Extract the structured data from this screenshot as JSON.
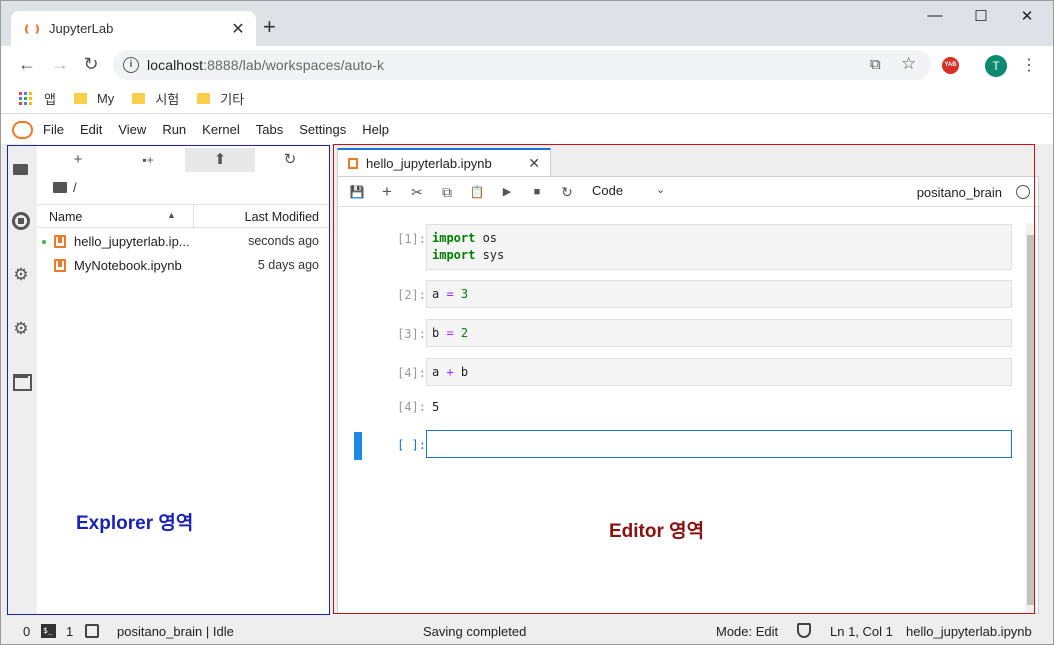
{
  "browser": {
    "tab_title": "JupyterLab",
    "tab_close": "✕",
    "new_tab": "+",
    "window_controls": {
      "minimize": "—",
      "maximize": "☐",
      "close": "✕"
    },
    "url_host": "localhost",
    "url_rest": ":8888/lab/workspaces/auto-k",
    "nav": {
      "back": "←",
      "forward": "→",
      "reload": "↻"
    },
    "info_glyph": "i",
    "translate_glyph": "⧉",
    "star_glyph": "☆",
    "yab_label": "YAB",
    "avatar_letter": "T",
    "menu_glyph": "⋮",
    "bookmarks": [
      "앱",
      "My",
      "시험",
      "기타"
    ]
  },
  "menubar": {
    "items": [
      "File",
      "Edit",
      "View",
      "Run",
      "Kernel",
      "Tabs",
      "Settings",
      "Help"
    ]
  },
  "sidebar": {
    "icons": [
      "folder-icon",
      "running-icon",
      "commands-icon",
      "settings-icon",
      "tabs-icon"
    ],
    "running_glyph": "",
    "commands_glyph": "⚙",
    "settings_glyph": "⚙"
  },
  "filebrowser": {
    "toolbar": {
      "new_launcher": "+",
      "new_folder": "▪+",
      "upload": "⬆",
      "refresh": "↻"
    },
    "breadcrumb": "/",
    "header": {
      "name": "Name",
      "modified": "Last Modified",
      "sort_glyph": "▲"
    },
    "files": [
      {
        "name": "hello_jupyterlab.ip...",
        "modified": "seconds ago",
        "running": true
      },
      {
        "name": "MyNotebook.ipynb",
        "modified": "5 days ago",
        "running": false
      }
    ]
  },
  "annotations": {
    "explorer": "Explorer 영역",
    "editor": "Editor 영역",
    "explorer_color": "#1a21b8",
    "editor_color": "#8a1010"
  },
  "notebook": {
    "tab_name": "hello_jupyterlab.ipynb",
    "tab_close": "✕",
    "toolbar": {
      "save": "💾",
      "insert": "+",
      "cut": "✂",
      "copy": "⧉",
      "paste": "📋",
      "run": "▶",
      "stop": "■",
      "restart": "↻",
      "cell_type": "Code",
      "cell_type_chevron": "⌄"
    },
    "kernel_name": "positano_brain",
    "cells": [
      {
        "prompt": "[1]:",
        "lines": [
          [
            "import",
            " os"
          ],
          [
            "import",
            " sys"
          ]
        ]
      },
      {
        "prompt": "[2]:",
        "code": [
          "a",
          " = ",
          "3"
        ]
      },
      {
        "prompt": "[3]:",
        "code": [
          "b",
          " = ",
          "2"
        ]
      },
      {
        "prompt": "[4]:",
        "code": [
          "a",
          " + ",
          "b"
        ]
      }
    ],
    "outputs": [
      {
        "prompt": "[4]:",
        "value": "5"
      }
    ],
    "active_prompt": "[ ]:"
  },
  "statusbar": {
    "terminals": "0",
    "kernels": "1",
    "kernel_status": "positano_brain | Idle",
    "message": "Saving completed",
    "mode": "Mode: Edit",
    "cursor": "Ln 1, Col 1",
    "file": "hello_jupyterlab.ipynb",
    "terminal_glyph": "$_"
  }
}
